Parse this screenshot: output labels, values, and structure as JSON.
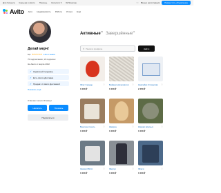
{
  "topbar": {
    "links": [
      "Для бизнеса",
      "Карьера в Авито",
      "Помощь",
      "Каталоги ▾",
      "#яПомогаю"
    ],
    "login": "Вход и регистрация",
    "post_button": "Разместить объявление"
  },
  "header": {
    "logo": "Avito",
    "nav": [
      "Авто",
      "Недвижимость",
      "Работа",
      "Услуги",
      "Ещё"
    ]
  },
  "profile": {
    "name": "Делай мерч!",
    "rating": "5,0",
    "stars": "★★★★★",
    "reviews": "116 отзывов",
    "followers": "70 подписчиков, 16 подписок",
    "since": "На Авито с марта 2022",
    "badges": [
      {
        "icon": "✓",
        "label": "Надёжный продавец"
      },
      {
        "icon": "✓",
        "label": "Есть Авито Доставка"
      },
      {
        "icon": "✓",
        "label": "Продаёт с Авито Доставкой"
      }
    ],
    "more_link": "Показать ещё",
    "response": "Отвечает около 30 минут",
    "write_button": "Написать",
    "call_button": "Показать",
    "subscribe_button": "Подписаться"
  },
  "listings": {
    "tab_active": "Активные",
    "tab_active_count": "63",
    "tab_inactive": "Завершённые",
    "tab_inactive_count": "11",
    "search_placeholder": "Поиск в профиле",
    "search_button": "Найти",
    "items": [
      {
        "title": "Флаг Сердце",
        "price": "1 000 ₽"
      },
      {
        "title": "Бейджи материалов",
        "price": "1 000 ₽"
      },
      {
        "title": "Наклейки Стикерпак",
        "price": "2 450 ₽"
      },
      {
        "title": "Брелоки печать",
        "price": "1 000 ₽"
      },
      {
        "title": "Шеврон",
        "price": "1 000 ₽"
      },
      {
        "title": "Кружки вкусных",
        "price": "1 000 ₽"
      },
      {
        "title": "Значки Mirror",
        "price": "1 000 ₽"
      },
      {
        "title": "Фартук",
        "price": "1 000 ₽"
      },
      {
        "title": "Флаги",
        "price": "1 000 ₽"
      }
    ]
  },
  "colors": {
    "accent": "#0a8cff",
    "logo_blue": "#00aaff",
    "logo_green": "#97cf26",
    "logo_red": "#ff6163",
    "logo_purple": "#a169f7"
  }
}
